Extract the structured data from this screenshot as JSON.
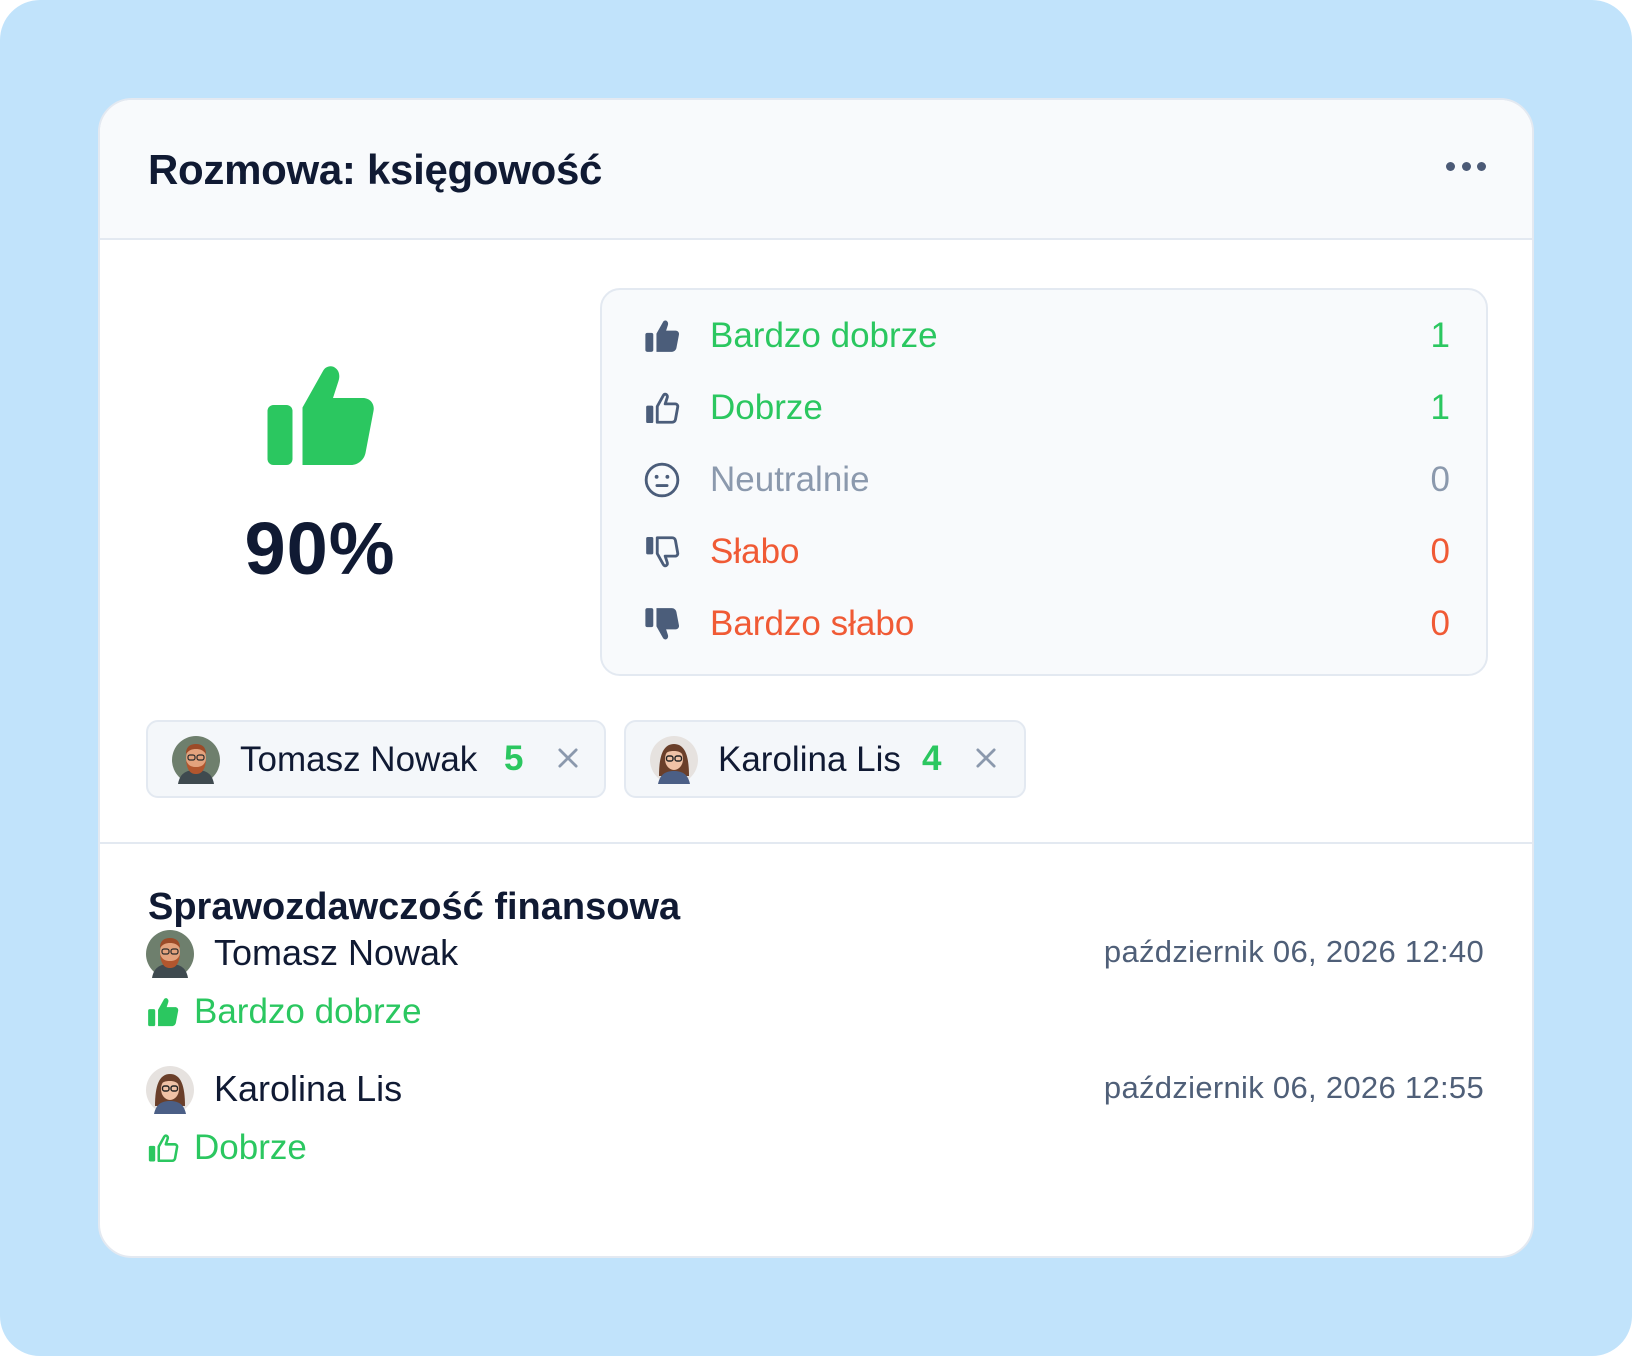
{
  "header": {
    "title": "Rozmowa: księgowość",
    "menu_icon": "more-horizontal-icon"
  },
  "score": {
    "icon": "thumbs-up-filled-icon",
    "value": "90%",
    "color": "#2bc760"
  },
  "breakdown": [
    {
      "icon": "thumbs-up-filled-icon",
      "label": "Bardzo dobrze",
      "count": "1",
      "color": "#2bc760"
    },
    {
      "icon": "thumbs-up-outline-icon",
      "label": "Dobrze",
      "count": "1",
      "color": "#2bc760"
    },
    {
      "icon": "neutral-face-icon",
      "label": "Neutralnie",
      "count": "0",
      "color": "#8b99ad"
    },
    {
      "icon": "thumbs-down-outline-icon",
      "label": "Słabo",
      "count": "0",
      "color": "#f05a35"
    },
    {
      "icon": "thumbs-down-filled-icon",
      "label": "Bardzo słabo",
      "count": "0",
      "color": "#f05a35"
    }
  ],
  "participants": [
    {
      "name": "Tomasz Nowak",
      "score": "5",
      "avatar": "avatar-man-beard",
      "remove_icon": "close-icon"
    },
    {
      "name": "Karolina Lis",
      "score": "4",
      "avatar": "avatar-woman-glasses",
      "remove_icon": "close-icon"
    }
  ],
  "section": {
    "title": "Sprawozdawczość finansowa",
    "reviews": [
      {
        "name": "Tomasz Nowak",
        "time": "październik 06, 2026 12:40",
        "rating_label": "Bardzo dobrze",
        "rating_icon": "thumbs-up-filled-icon"
      },
      {
        "name": "Karolina Lis",
        "time": "październik 06, 2026 12:55",
        "rating_label": "Dobrze",
        "rating_icon": "thumbs-up-outline-icon"
      }
    ]
  },
  "colors": {
    "background": "#c1e3fb",
    "positive": "#2bc760",
    "negative": "#f05a35",
    "neutral": "#8b99ad",
    "text": "#101a33"
  }
}
